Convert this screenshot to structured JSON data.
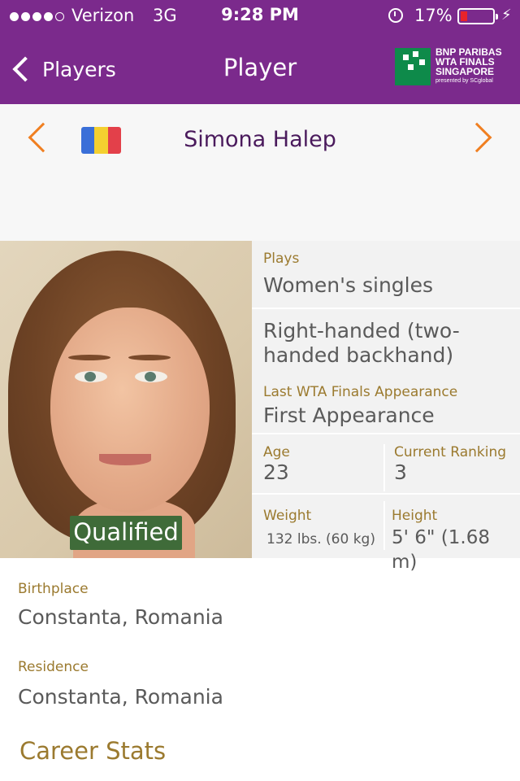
{
  "status_bar": {
    "carrier": "Verizon",
    "network": "3G",
    "time": "9:28 PM",
    "battery_percent": "17%",
    "icons": [
      "signal-dots-icon",
      "alarm-icon",
      "battery-icon",
      "charging-bolt-icon"
    ]
  },
  "nav": {
    "back_label": "Players",
    "title": "Player",
    "logo_lines": [
      "BNP PARIBAS",
      "WTA FINALS",
      "SINGAPORE",
      "presented by SCglobal"
    ]
  },
  "player": {
    "name": "Simona Halep",
    "flag_colors": [
      "#3a6fd8",
      "#f4d030",
      "#e3404a"
    ],
    "status_badge": "Qualified"
  },
  "stats": {
    "plays_label": "Plays",
    "plays_value": "Women's singles",
    "handedness": "Right-handed (two-handed backhand)",
    "last_finals_label": "Last WTA Finals Appearance",
    "last_finals_value": "First Appearance",
    "age_label": "Age",
    "age_value": "23",
    "ranking_label": "Current Ranking",
    "ranking_value": "3",
    "weight_label": "Weight",
    "weight_value": "132 lbs. (60 kg)",
    "height_label": "Height",
    "height_value": "5' 6\" (1.68 m)"
  },
  "details": {
    "birthplace_label": "Birthplace",
    "birthplace_value": "Constanta, Romania",
    "residence_label": "Residence",
    "residence_value": "Constanta, Romania",
    "career_stats_label": "Career Stats"
  },
  "colors": {
    "brand_purple": "#7b2a8c",
    "accent_orange": "#f07f21",
    "label_gold": "#9b7a2f",
    "badge_green": "#3f6b39"
  }
}
